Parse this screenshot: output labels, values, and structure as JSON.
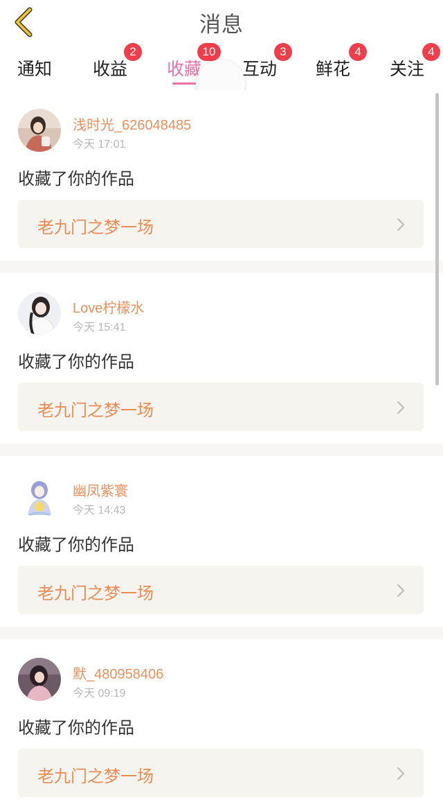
{
  "header": {
    "title": "消息",
    "back_icon": "chevron-left-icon",
    "back_icon_color": "#f0c030"
  },
  "tabs": [
    {
      "label": "通知",
      "badge": ""
    },
    {
      "label": "收益",
      "badge": "2"
    },
    {
      "label": "收藏",
      "badge": "10",
      "active": true
    },
    {
      "label": "互动",
      "badge": "3"
    },
    {
      "label": "鲜花",
      "badge": "4"
    },
    {
      "label": "关注",
      "badge": "4"
    }
  ],
  "colors": {
    "accent_pink": "#ec6fa6",
    "badge_red": "#ef3d4a",
    "username_orange": "#e8905d",
    "work_title_orange": "#eb8a52"
  },
  "messages": [
    {
      "username": "浅时光_626048485",
      "time": "今天 17:01",
      "action": "收藏了你的作品",
      "work_title": "老九门之梦一场"
    },
    {
      "username": "Love柠檬水",
      "time": "今天 15:41",
      "action": "收藏了你的作品",
      "work_title": "老九门之梦一场"
    },
    {
      "username": "幽凤紫寰",
      "time": "今天 14:43",
      "action": "收藏了你的作品",
      "work_title": "老九门之梦一场"
    },
    {
      "username": "默_480958406",
      "time": "今天 09:19",
      "action": "收藏了你的作品",
      "work_title": "老九门之梦一场"
    }
  ]
}
